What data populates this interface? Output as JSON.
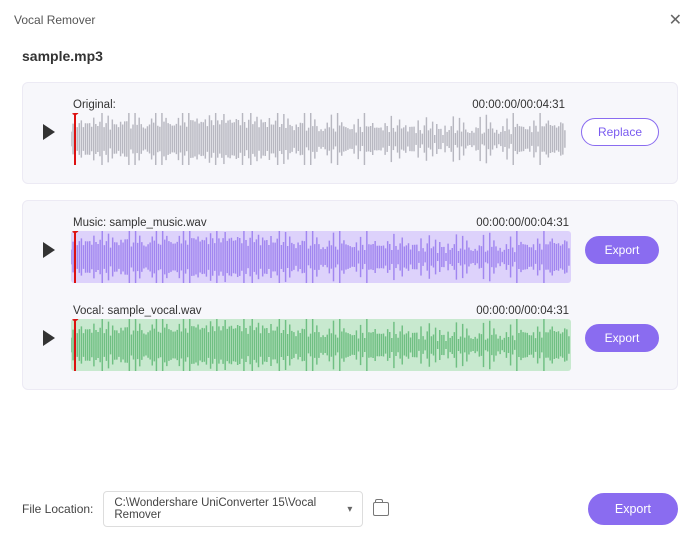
{
  "window": {
    "title": "Vocal Remover"
  },
  "file": {
    "name": "sample.mp3"
  },
  "tracks": {
    "original": {
      "label": "Original:",
      "time": "00:00:00/00:04:31",
      "button": "Replace",
      "wave_color": "#b7b7c0"
    },
    "music": {
      "label": "Music: sample_music.wav",
      "time": "00:00:00/00:04:31",
      "button": "Export",
      "wave_color": "#a186f0",
      "wave_bg": "#ddd2fb"
    },
    "vocal": {
      "label": "Vocal: sample_vocal.wav",
      "time": "00:00:00/00:04:31",
      "button": "Export",
      "wave_color": "#6fbf82",
      "wave_bg": "#c8e9cf"
    }
  },
  "footer": {
    "label": "File Location:",
    "path": "C:\\Wondershare UniConverter 15\\Vocal Remover",
    "export": "Export"
  }
}
